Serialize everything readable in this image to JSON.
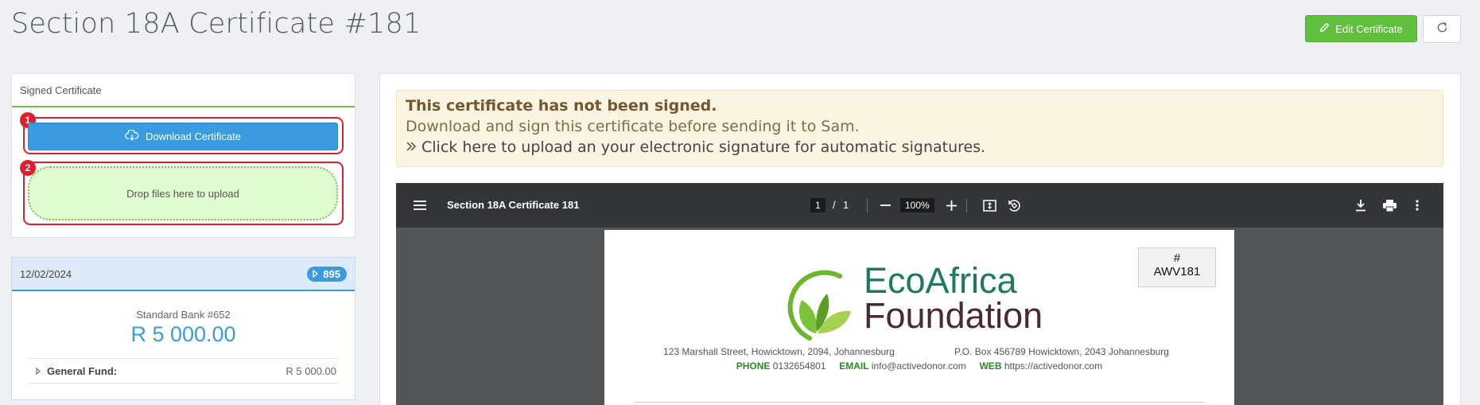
{
  "page": {
    "title": "Section 18A Certificate #181"
  },
  "header": {
    "edit_label": "Edit Certificate"
  },
  "signed_card": {
    "title": "Signed Certificate",
    "download_label": "Download Certificate",
    "dropzone_text": "Drop files here to upload",
    "markers": [
      "1",
      "2"
    ]
  },
  "payment": {
    "date": "12/02/2024",
    "badge": "895",
    "bank": "Standard Bank #652",
    "amount": "R 5 000.00",
    "fund_label": "General Fund:",
    "fund_value": "R 5 000.00"
  },
  "alert": {
    "title": "This certificate has not been signed.",
    "text": "Download and sign this certificate before sending it to Sam.",
    "link": "Click here to upload an your electronic signature for automatic signatures."
  },
  "viewer": {
    "doc_title": "Section 18A Certificate 181",
    "page_current": "1",
    "page_sep": "/",
    "page_total": "1",
    "zoom": "100%"
  },
  "pdf": {
    "cert_hash": "#",
    "cert_no": "AWV181",
    "org_line1": "EcoAfrica",
    "org_line2": "Foundation",
    "address1": "123 Marshall Street, Howicktown, 2094, Johannesburg",
    "address2": "P.O. Box 456789 Howicktown, 2043 Johannesburg",
    "phone_label": "PHONE",
    "phone": "0132654801",
    "email_label": "EMAIL",
    "email": "info@activedonor.com",
    "web_label": "WEB",
    "web": "https://activedonor.com"
  },
  "colors": {
    "success": "#5fc13b",
    "primary": "#3b9be0",
    "marker": "#e01e2d"
  },
  "icons": [
    "pencil-icon",
    "refresh-icon",
    "cloud-download-icon",
    "caret-right-icon",
    "double-chevron-right-icon",
    "menu-icon",
    "minus-icon",
    "plus-icon",
    "fit-page-icon",
    "rotate-icon",
    "download-icon",
    "print-icon",
    "more-vertical-icon",
    "leaf-logo-icon"
  ]
}
